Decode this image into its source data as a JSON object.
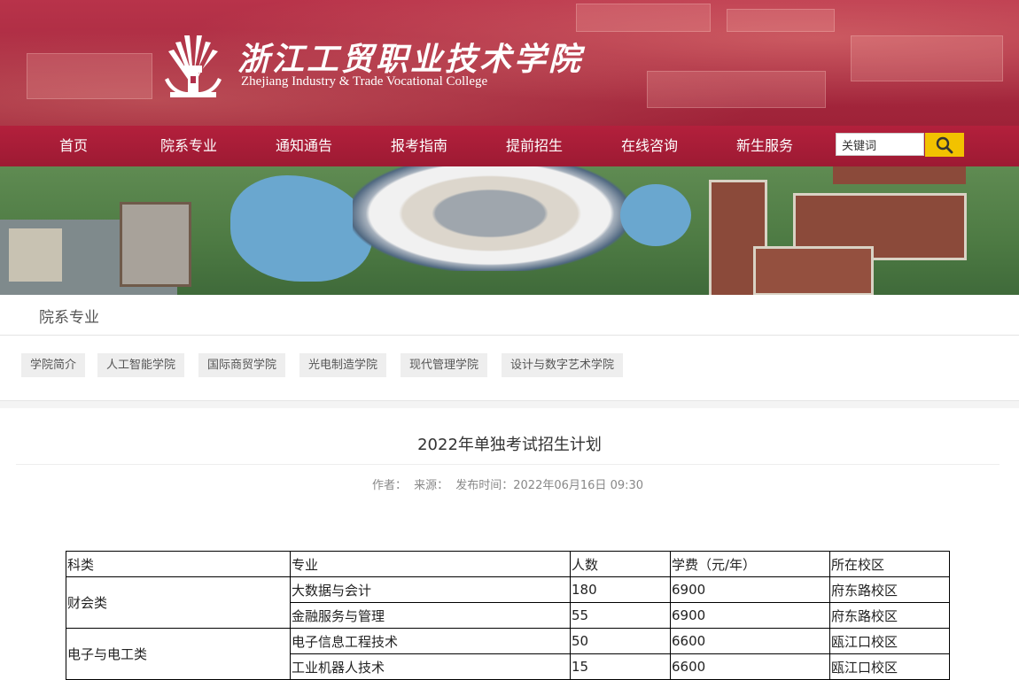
{
  "header": {
    "logo_cn": "浙江工贸职业技术学院",
    "logo_en": "Zhejiang Industry & Trade Vocational College"
  },
  "nav": {
    "items": [
      "首页",
      "院系专业",
      "通知通告",
      "报考指南",
      "提前招生",
      "在线咨询",
      "新生服务"
    ],
    "search": {
      "value": "关键词",
      "icon": "search-icon"
    }
  },
  "section": {
    "title": "院系专业",
    "tabs": [
      "学院简介",
      "人工智能学院",
      "国际商贸学院",
      "光电制造学院",
      "现代管理学院",
      "设计与数字艺术学院"
    ]
  },
  "article": {
    "title": "2022年单独考试招生计划",
    "meta": {
      "author": "作者：",
      "source": "来源：",
      "publish": "发布时间：2022年06月16日 09:30"
    }
  },
  "table": {
    "headers": [
      "科类",
      "专业",
      "人数",
      "学费（元/年）",
      "所在校区"
    ],
    "groups": [
      {
        "category": "财会类",
        "rows": [
          [
            "大数据与会计",
            "180",
            "6900",
            "府东路校区"
          ],
          [
            "金融服务与管理",
            "55",
            "6900",
            "府东路校区"
          ]
        ]
      },
      {
        "category": "电子与电工类",
        "rows": [
          [
            "电子信息工程技术",
            "50",
            "6600",
            "瓯江口校区"
          ],
          [
            "工业机器人技术",
            "15",
            "6600",
            "瓯江口校区"
          ]
        ]
      }
    ]
  },
  "colors": {
    "nav_red": "#a51c36",
    "header_red": "#b0304a",
    "search_yellow": "#f2c200"
  }
}
